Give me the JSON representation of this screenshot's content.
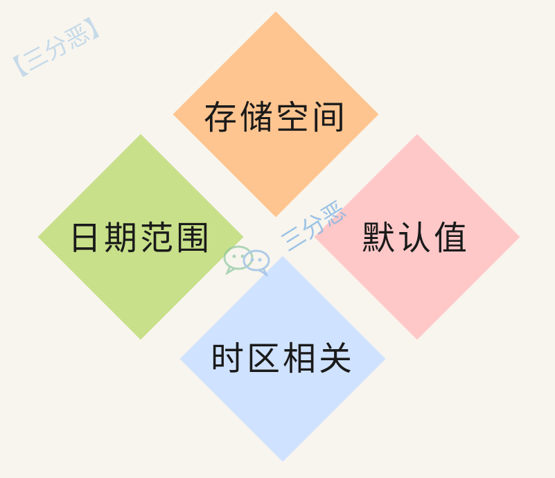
{
  "quadrants": {
    "top": {
      "label": "存储空间",
      "color": "#ffc590"
    },
    "left": {
      "label": "日期范围",
      "color": "#c8e08a"
    },
    "right": {
      "label": "默认值",
      "color": "#ffc8c8"
    },
    "bottom": {
      "label": "时区相关",
      "color": "#cfe2ff"
    }
  },
  "watermark": {
    "corner_text": "【三分恶】",
    "center_text": "三分恶",
    "icon": "wechat-icon"
  }
}
